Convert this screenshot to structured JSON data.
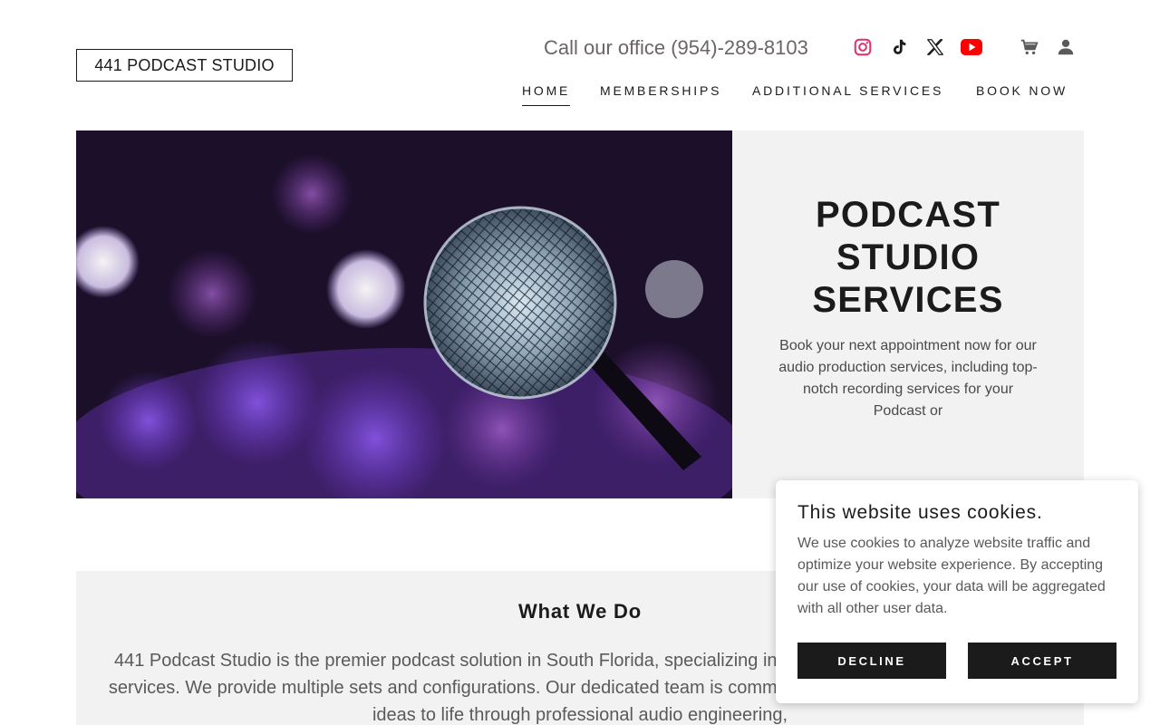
{
  "header": {
    "logo_text": "441 PODCAST STUDIO",
    "phone_text": "Call our office (954)-289-8103",
    "social_icons": [
      "instagram-icon",
      "tiktok-icon",
      "x-icon",
      "youtube-icon"
    ],
    "utility_icons": [
      "cart-icon",
      "account-icon"
    ],
    "nav": [
      {
        "label": "HOME",
        "active": true
      },
      {
        "label": "MEMBERSHIPS",
        "active": false
      },
      {
        "label": "ADDITIONAL SERVICES",
        "active": false
      },
      {
        "label": "BOOK NOW",
        "active": false
      }
    ]
  },
  "hero": {
    "title": "PODCAST\nSTUDIO\nSERVICES",
    "text": "Book your next appointment now for our audio production services, including top-notch recording services for your Podcast or"
  },
  "what_we_do": {
    "title": "What We Do",
    "text": "441 Podcast Studio is the premier podcast solution in South Florida, specializing in affordable, high-quality recording services. We provide multiple sets and configurations. Our dedicated team is committed to helping creators bring their ideas to life through professional audio engineering,"
  },
  "cookie": {
    "title": "This website uses cookies.",
    "text": "We use cookies to analyze website traffic and optimize your website experience. By accepting our use of cookies, your data will be aggregated with all other user data.",
    "decline_label": "DECLINE",
    "accept_label": "ACCEPT"
  },
  "colors": {
    "text_dark": "#1b1b1b",
    "panel_bg": "#f2f2f2",
    "instagram": "#e1306c",
    "youtube": "#ff0000",
    "button_bg": "#1b1b1b"
  }
}
